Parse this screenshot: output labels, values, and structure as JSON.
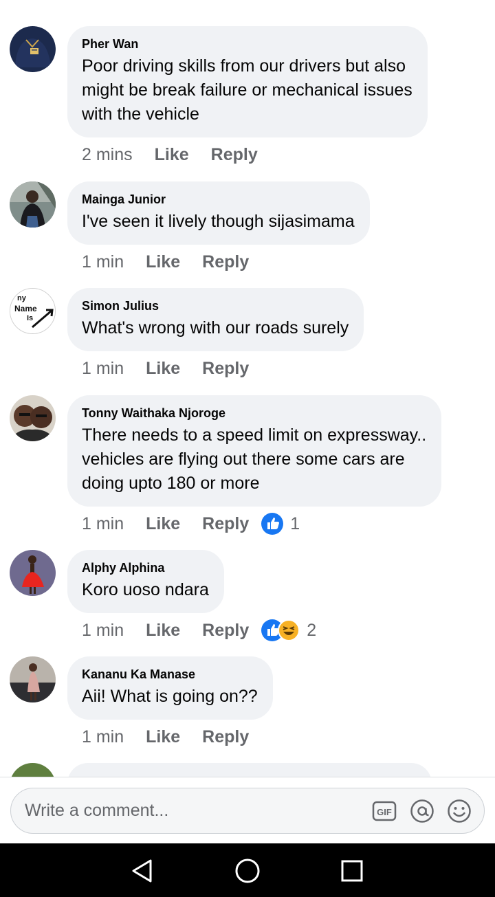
{
  "comments": [
    {
      "author": "Pher Wan",
      "lines": [
        "Poor driving skills from our drivers but also",
        "might be break failure or mechanical issues",
        "with the vehicle"
      ],
      "time": "2 mins",
      "like_label": "Like",
      "reply_label": "Reply",
      "avatar": "avatar-photo-jersey"
    },
    {
      "author": "Mainga Junior",
      "lines": [
        "I've seen it lively though sijasimama"
      ],
      "time": "1 min",
      "like_label": "Like",
      "reply_label": "Reply",
      "avatar": "avatar-photo-man"
    },
    {
      "author": "Simon Julius",
      "lines": [
        "What's wrong with our roads surely"
      ],
      "time": "1 min",
      "like_label": "Like",
      "reply_label": "Reply",
      "avatar": "avatar-my-name-is",
      "avatar_text": [
        "ny",
        "Name",
        "Is"
      ]
    },
    {
      "author": "Tonny Waithaka Njoroge",
      "lines": [
        "There needs to a speed limit on expressway..",
        "vehicles are flying out there some cars are",
        "doing upto 180 or more"
      ],
      "time": "1 min",
      "like_label": "Like",
      "reply_label": "Reply",
      "avatar": "avatar-photo-couple",
      "reactions": [
        "like-reaction-icon"
      ],
      "reaction_count": "1"
    },
    {
      "author": "Alphy Alphina",
      "lines": [
        "Koro uoso ndara"
      ],
      "time": "1 min",
      "like_label": "Like",
      "reply_label": "Reply",
      "avatar": "avatar-photo-red-dress",
      "reactions": [
        "like-reaction-icon",
        "haha-reaction-icon"
      ],
      "reaction_count": "2"
    },
    {
      "author": "Kananu Ka Manase",
      "lines": [
        "Aii! What is going on??"
      ],
      "time": "1 min",
      "like_label": "Like",
      "reply_label": "Reply",
      "avatar": "avatar-photo-sofa"
    }
  ],
  "composer": {
    "placeholder": "Write a comment...",
    "icons": [
      "gif-icon",
      "mention-icon",
      "emoji-icon"
    ]
  },
  "navbar": {
    "icons": [
      "back-triangle-icon",
      "home-circle-icon",
      "recents-square-icon"
    ]
  },
  "colors": {
    "bubble_bg": "#f0f2f5",
    "meta_text": "#65676b",
    "like_blue": "#1877f2",
    "haha_yellow": "#f7b125"
  }
}
